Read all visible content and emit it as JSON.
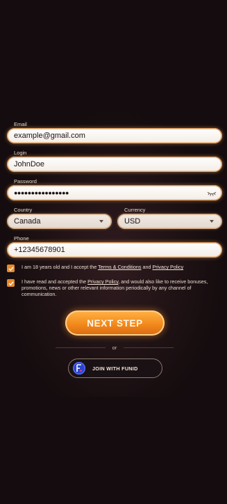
{
  "form": {
    "email": {
      "label": "Email",
      "value": "example@gmail.com"
    },
    "login": {
      "label": "Login",
      "value": "JohnDoe"
    },
    "password": {
      "label": "Password",
      "value": "●●●●●●●●●●●●●●●●"
    },
    "country": {
      "label": "Country",
      "value": "Canada"
    },
    "currency": {
      "label": "Currency",
      "value": "USD"
    },
    "phone": {
      "label": "Phone",
      "value": "+12345678901"
    }
  },
  "consent": {
    "age_prefix": "I am 18 years old and I accept the ",
    "terms_link": "Terms & Conditions",
    "and": " and ",
    "privacy_link": "Privacy Policy",
    "marketing_prefix": "I have read and accepted the ",
    "marketing_link": "Privacy Policy",
    "marketing_suffix": ", and would also like to receive bonuses, promotions, news or other relevant information periodically by any channel of communication."
  },
  "actions": {
    "next_label": "NEXT STEP",
    "or_label": "or",
    "funid_label": "JOIN WITH FUNID"
  },
  "colors": {
    "accent": "#f38a1c",
    "checkbox": "#e88a2a",
    "background": "#140c0e",
    "funid_brand": "#2b44c9"
  },
  "icons": {
    "password_toggle": "eye-closed-icon",
    "dropdown": "chevron-down-icon",
    "checkbox": "check-icon",
    "funid": "funid-logo-icon"
  }
}
